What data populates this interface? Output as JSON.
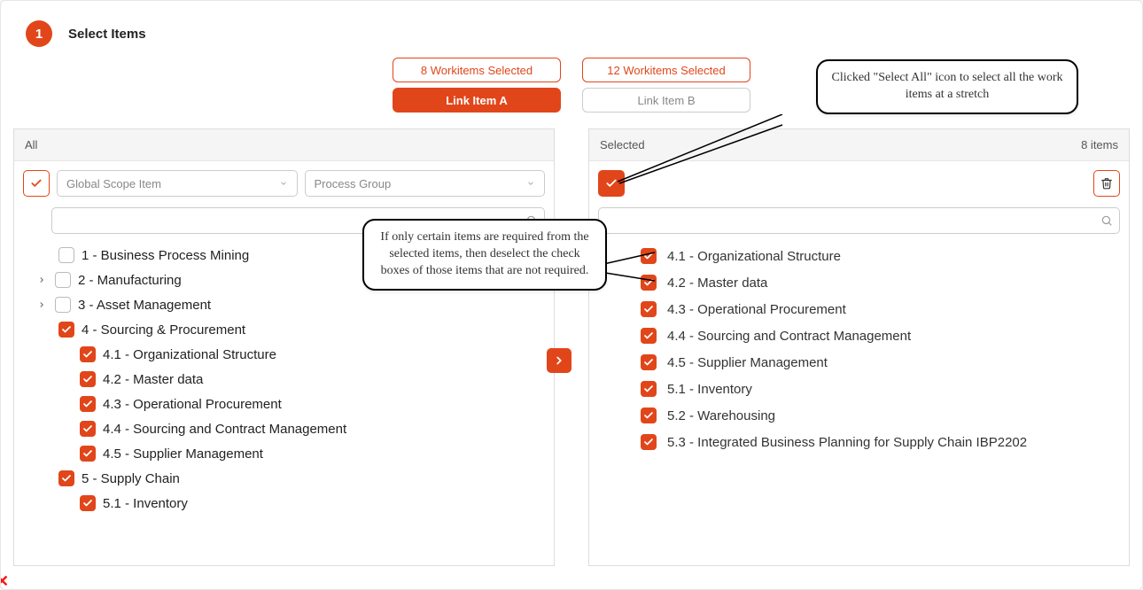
{
  "header": {
    "step_number": "1",
    "step_title": "Select Items"
  },
  "pills": {
    "a_count_label": "8 Workitems Selected",
    "a_link_label": "Link Item A",
    "b_count_label": "12 Workitems Selected",
    "b_link_label": "Link Item B"
  },
  "left_panel": {
    "head_label": "All",
    "scope_placeholder": "Global Scope Item",
    "group_placeholder": "Process Group",
    "search_placeholder": "",
    "items": [
      {
        "indent": 0,
        "caret": false,
        "checked": false,
        "label": "1 - Business Process Mining"
      },
      {
        "indent": 0,
        "caret": true,
        "checked": false,
        "label": "2 - Manufacturing"
      },
      {
        "indent": 0,
        "caret": true,
        "checked": false,
        "label": "3 - Asset Management"
      },
      {
        "indent": 0,
        "caret": false,
        "checked": true,
        "label": "4 - Sourcing & Procurement"
      },
      {
        "indent": 1,
        "caret": false,
        "checked": true,
        "label": "4.1 - Organizational Structure"
      },
      {
        "indent": 1,
        "caret": false,
        "checked": true,
        "label": "4.2 - Master data"
      },
      {
        "indent": 1,
        "caret": false,
        "checked": true,
        "label": "4.3 - Operational Procurement"
      },
      {
        "indent": 1,
        "caret": false,
        "checked": true,
        "label": "4.4 - Sourcing and Contract Management"
      },
      {
        "indent": 1,
        "caret": false,
        "checked": true,
        "label": "4.5 - Supplier Management"
      },
      {
        "indent": 0,
        "caret": false,
        "checked": true,
        "label": "5 - Supply Chain"
      },
      {
        "indent": 1,
        "caret": false,
        "checked": true,
        "label": "5.1 - Inventory"
      }
    ]
  },
  "right_panel": {
    "head_label": "Selected",
    "count_label": "8 items",
    "search_placeholder": "",
    "items": [
      {
        "label": "4.1 - Organizational Structure"
      },
      {
        "label": "4.2 - Master data"
      },
      {
        "label": "4.3 - Operational Procurement"
      },
      {
        "label": "4.4 - Sourcing and Contract Management"
      },
      {
        "label": "4.5 - Supplier Management"
      },
      {
        "label": "5.1 - Inventory"
      },
      {
        "label": "5.2 - Warehousing"
      },
      {
        "label": "5.3 - Integrated Business Planning for Supply Chain IBP2202"
      }
    ]
  },
  "callouts": {
    "c1": "Clicked \"Select All\" icon to select all the work items at a stretch",
    "c2": "If only certain items are required from the selected items, then deselect the check boxes of those items that are not required."
  },
  "colors": {
    "accent": "#e1461a",
    "border": "#cccccc"
  }
}
